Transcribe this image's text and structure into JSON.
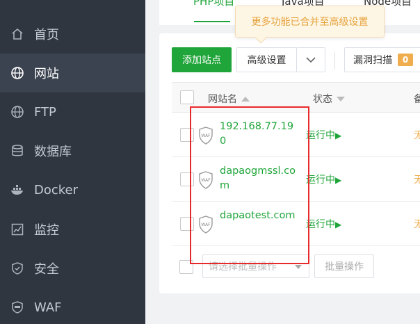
{
  "sidebar": {
    "items": [
      {
        "label": "首页",
        "icon": "home-icon",
        "active": false
      },
      {
        "label": "网站",
        "icon": "globe-icon",
        "active": true
      },
      {
        "label": "FTP",
        "icon": "ftp-globe-icon",
        "active": false
      },
      {
        "label": "数据库",
        "icon": "database-icon",
        "active": false
      },
      {
        "label": "Docker",
        "icon": "docker-icon",
        "active": false
      },
      {
        "label": "监控",
        "icon": "monitor-icon",
        "active": false
      },
      {
        "label": "安全",
        "icon": "shield-icon",
        "active": false
      },
      {
        "label": "WAF",
        "icon": "waf-icon",
        "active": false
      }
    ]
  },
  "tabs": [
    {
      "label": "PHP项目",
      "active": true
    },
    {
      "label": "Java项目",
      "active": false
    },
    {
      "label": "Node项目",
      "active": false
    }
  ],
  "tooltip": {
    "text": "更多功能已合并至高级设置"
  },
  "toolbar": {
    "add_site_label": "添加站点",
    "advanced_label": "高级设置",
    "vuln_scan_label": "漏洞扫描",
    "vuln_count": "0"
  },
  "table": {
    "headers": {
      "name": "网站名",
      "status": "状态",
      "truncated": "备"
    },
    "rows": [
      {
        "name": "192.168.77.190",
        "status": "运行中",
        "extra": "无"
      },
      {
        "name": "dapaogmssl.com",
        "status": "运行中",
        "extra": "无"
      },
      {
        "name": "dapaotest.com",
        "status": "运行中",
        "extra": "无"
      }
    ],
    "waf_badge": "WAF"
  },
  "batch": {
    "placeholder": "请选择批量操作",
    "button_label": "批量操作"
  },
  "colors": {
    "accent": "#20a53a",
    "sidebar_bg": "#2f3640",
    "highlight": "#e8292c",
    "warning": "#f0ad4e"
  }
}
